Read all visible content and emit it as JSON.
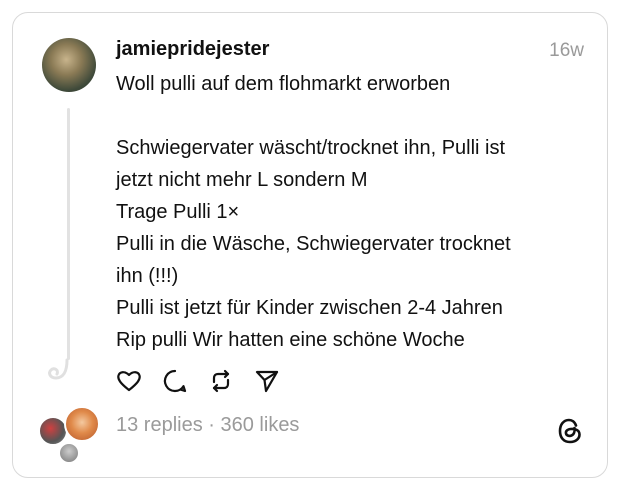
{
  "post": {
    "username": "jamiepridejester",
    "timestamp": "16w",
    "text_lines": [
      "Woll pulli auf dem flohmarkt erworben",
      "",
      "Schwiegervater wäscht/trocknet ihn, Pulli ist",
      "jetzt nicht mehr L sondern M",
      "Trage Pulli 1×",
      "Pulli in die Wäsche, Schwiegervater trocknet",
      "ihn (!!!)",
      "Pulli ist jetzt für Kinder zwischen 2-4 Jahren",
      "Rip pulli Wir hatten eine schöne Woche"
    ]
  },
  "actions": {
    "icons": [
      "heart-icon",
      "comment-icon",
      "repost-icon",
      "share-icon"
    ]
  },
  "stats": {
    "replies": "13 replies",
    "separator": " · ",
    "likes": "360 likes"
  },
  "logo": {
    "icon": "threads-logo-icon"
  }
}
